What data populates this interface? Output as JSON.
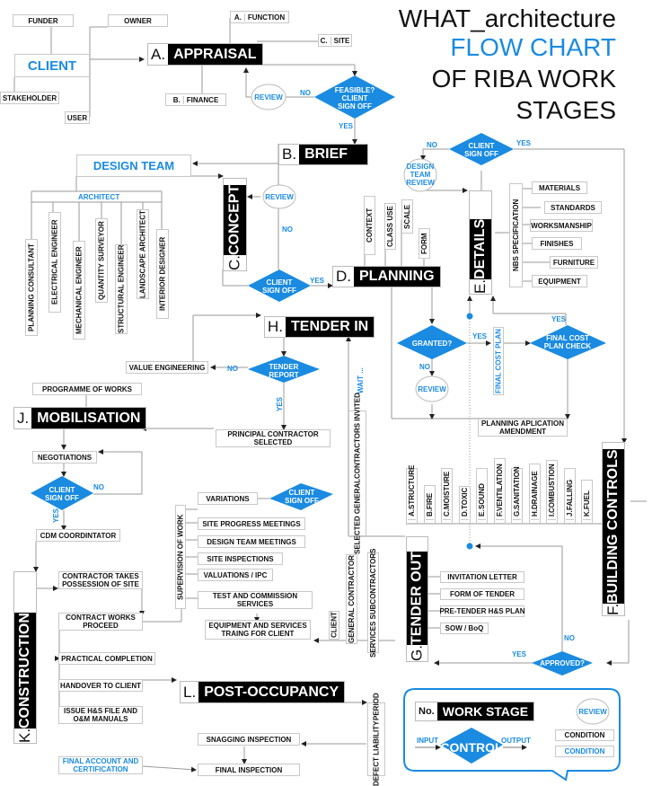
{
  "title": {
    "line1": "WHAT_architecture",
    "line2": "FLOW CHART",
    "line3": "OF RIBA WORK",
    "line4": "STAGES"
  },
  "colors": {
    "accent": "#1a8be0",
    "stage_bg": "#000000",
    "line": "#999999"
  },
  "client": {
    "label": "CLIENT",
    "roles": [
      "FUNDER",
      "OWNER",
      "STAKEHOLDER",
      "USER"
    ]
  },
  "stages": {
    "A": {
      "code": "A.",
      "name": "APPRAISAL"
    },
    "B": {
      "code": "B.",
      "name": "BRIEF"
    },
    "C": {
      "code": "C.",
      "name": "CONCEPT"
    },
    "D": {
      "code": "D.",
      "name": "PLANNING"
    },
    "E": {
      "code": "E.",
      "name": "DETAILS"
    },
    "F": {
      "code": "F.",
      "name": "BUILDING CONTROLS"
    },
    "G": {
      "code": "G.",
      "name": "TENDER OUT"
    },
    "H": {
      "code": "H.",
      "name": "TENDER IN"
    },
    "J": {
      "code": "J.",
      "name": "MOBILISATION"
    },
    "K": {
      "code": "K.",
      "name": "CONSTRUCTION"
    },
    "L": {
      "code": "L.",
      "name": "POST-OCCUPANCY"
    }
  },
  "appraisal": {
    "items": [
      {
        "pre": "A.",
        "text": "FUNCTION"
      },
      {
        "pre": "B.",
        "text": "FINANCE"
      },
      {
        "pre": "C.",
        "text": "SITE"
      }
    ],
    "decision": [
      "FEASIBLE?",
      "CLIENT",
      "SIGN OFF"
    ],
    "review": "REVIEW",
    "no": "NO",
    "yes": "YES"
  },
  "design_team": {
    "label": "DESIGN TEAM",
    "architect": "ARCHITECT",
    "members": [
      "PLANNING CONSULTANT",
      "ELECTRICAL ENGINEER",
      "MECHANICAL ENGINEER",
      "QUANTITY SURVEYOR",
      "STRUCTURAL ENGINEER",
      "LANDSCAPE ARCHITECT",
      "INTERIOR DESIGNER"
    ]
  },
  "concept": {
    "review": "REVIEW",
    "no": "NO",
    "yes": "YES",
    "decision": [
      "CLIENT",
      "SIGN OFF"
    ]
  },
  "planning": {
    "items": [
      "CONTEXT",
      "CLASS USE",
      "SCALE",
      "FORM"
    ],
    "decision": "GRANTED?",
    "yes": "YES",
    "no": "NO",
    "review": "REVIEW",
    "amendment": [
      "PLANNING APLICATION",
      "AMENDMENT"
    ],
    "final_cost_plan": "FINAL COST PLAN",
    "cost_check": [
      "FINAL COST",
      "PLAN CHECK"
    ],
    "cost_yes": "YES"
  },
  "details": {
    "top_decision": [
      "CLIENT",
      "SIGN OFF"
    ],
    "no": "NO",
    "yes": "YES",
    "review": [
      "DESIGN",
      "TEAM",
      "REVIEW"
    ],
    "spec_label": "NBS SPECIFICATION",
    "spec_items": [
      "MATERIALS",
      "STANDARDS",
      "WORKSMANSHIP",
      "FINISHES",
      "FURNITURE",
      "EQUIPMENT"
    ]
  },
  "building_controls": {
    "items": [
      {
        "pre": "A.",
        "text": "STRUCTURE"
      },
      {
        "pre": "B.",
        "text": "FIRE"
      },
      {
        "pre": "C.",
        "text": "MOISTURE"
      },
      {
        "pre": "D.",
        "text": "TOXIC"
      },
      {
        "pre": "E.",
        "text": "SOUND"
      },
      {
        "pre": "F.",
        "text": "VENTILATION"
      },
      {
        "pre": "G.",
        "text": "SANITATION"
      },
      {
        "pre": "H.",
        "text": "DRAINAGE"
      },
      {
        "pre": "I.",
        "text": "COMBUSTION"
      },
      {
        "pre": "J.",
        "text": "FALLING"
      },
      {
        "pre": "K.",
        "text": "FUEL"
      }
    ],
    "decision": "APPROVED?",
    "no": "NO",
    "yes": "YES"
  },
  "tender_out": {
    "items": [
      "INVITATION LETTER",
      "FORM OF TENDER",
      "PRE-TENDER H&S PLAN",
      "SOW / BoQ"
    ],
    "invited": [
      "SELECTED GENERAL",
      "CONTRACTORS INVITED"
    ],
    "wait": "WAIT ..."
  },
  "tender_in": {
    "decision": [
      "TENDER",
      "REPORT"
    ],
    "no": "NO",
    "yes": "YES",
    "value_engineering": "VALUE ENGINEERING",
    "selected": [
      "PRINCIPAL CONTRACTOR",
      "SELECTED"
    ]
  },
  "mobilisation": {
    "programme": "PROGRAMME OF WORKS",
    "negotiations": "NEGOTIATIONS",
    "decision": [
      "CLIENT",
      "SIGN OFF"
    ],
    "no": "NO",
    "yes": "YES",
    "cdm": "CDM COORDINTATOR"
  },
  "construction": {
    "steps": [
      [
        "CONTRACTOR TAKES",
        "POSSESSION OF SITE"
      ],
      [
        "CONTRACT WORKS",
        "PROCEED"
      ],
      [
        "PRACTICAL COMPLETION"
      ],
      [
        "HANDOVER TO CLIENT"
      ],
      [
        "ISSUE H&S FILE AND",
        "O&M MANUALS"
      ]
    ],
    "supervision": "SUPERVISION OF WORK",
    "supervision_items": [
      "VARIATIONS",
      "SITE PROGRESS MEETINGS",
      "DESIGN TEAM MEETINGS",
      "SITE INSPECTIONS",
      "VALUATIONS / IPC"
    ],
    "test": [
      "TEST AND COMMISSION",
      "SERVICES"
    ],
    "training": [
      "EQUIPMENT AND SERVICES",
      "TRAING FOR CLIENT"
    ],
    "variation_decision": [
      "CLIENT",
      "SIGN OFF"
    ],
    "parties": [
      "CLIENT",
      "GENERAL CONTRACTOR",
      "SERVICES SUBCONTRACTORS"
    ]
  },
  "post_occupancy": {
    "defect": [
      "DEFECT LIABILITY",
      "PERIOD"
    ],
    "snagging": "SNAGGING INSPECTION",
    "final_inspection": "FINAL INSPECTION",
    "final_account": [
      "FINAL ACCOUNT AND",
      "CERTIFICATION"
    ]
  },
  "legend": {
    "code": "No.",
    "name": "WORK STAGE",
    "review": "REVIEW",
    "input": "INPUT",
    "output": "OUTPUT",
    "control": "CONTROL",
    "condition_black": "CONDITION",
    "condition_blue": "CONDITION"
  }
}
